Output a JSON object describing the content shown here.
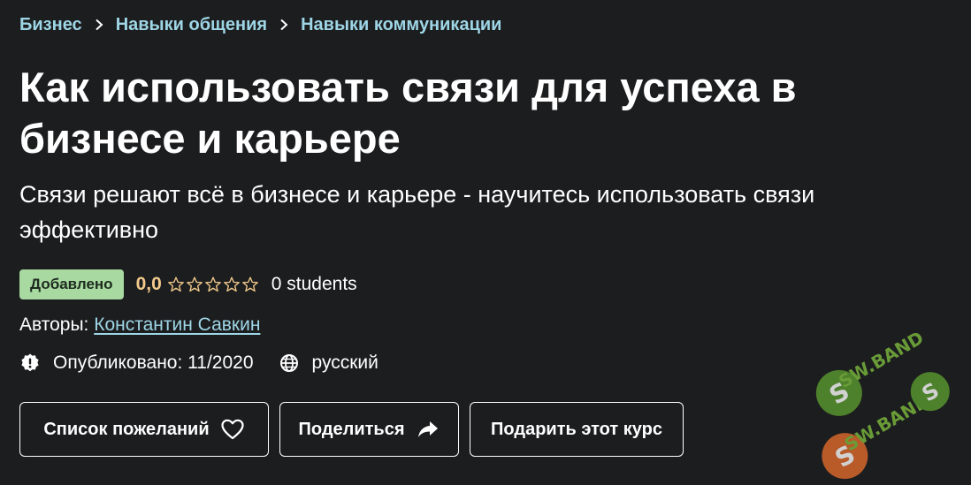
{
  "breadcrumb": {
    "items": [
      "Бизнес",
      "Навыки общения",
      "Навыки коммуникации"
    ]
  },
  "course": {
    "title": "Как использовать связи для успеха в бизнесе и карьере",
    "subtitle": "Связи решают всё в бизнесе и карьере - научитесь использовать связи эффективно"
  },
  "meta": {
    "badge": "Добавлено",
    "rating": "0,0",
    "stars": 0,
    "max_stars": 5,
    "students": "0 students"
  },
  "authors": {
    "label": "Авторы:",
    "name": "Константин Савкин"
  },
  "info": {
    "published": "Опубликовано: 11/2020",
    "language": "русский"
  },
  "buttons": {
    "wishlist": "Список пожеланий",
    "share": "Поделиться",
    "gift": "Подарить этот курс"
  },
  "colors": {
    "background": "#1c1d1f",
    "link": "#9ed6e6",
    "badge_bg": "#a8d9a0",
    "rating": "#f3ca8c"
  },
  "icons": {
    "breadcrumb_separator": "chevron-right-icon",
    "star": "star-outline-icon",
    "published": "alert-badge-icon",
    "language": "globe-icon",
    "wishlist": "heart-icon",
    "share": "share-arrow-icon"
  }
}
